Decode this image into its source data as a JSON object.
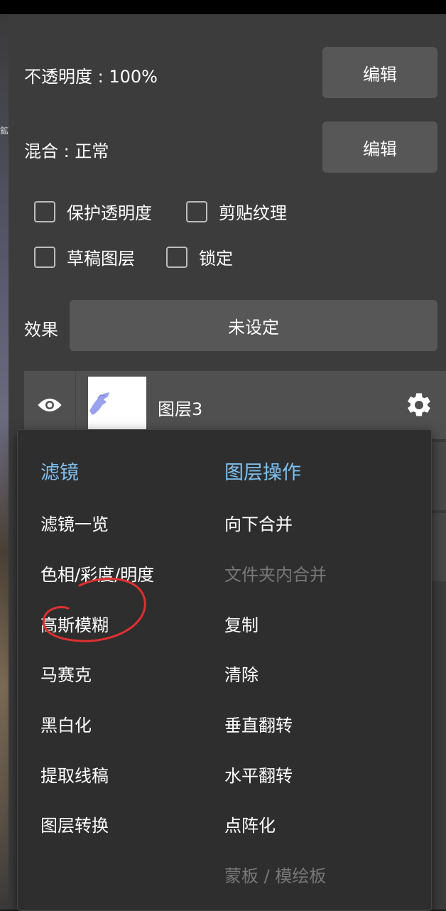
{
  "colors": {
    "panel": "#3c3c3c",
    "button": "#575757",
    "menu": "#2e2e2e",
    "accent": "#7ec0f0",
    "disabled": "#777777",
    "annotation": "#e03030"
  },
  "background": {
    "edge_glyph": "鉱"
  },
  "opacity": {
    "label": "不透明度 : 100%",
    "edit_label": "编辑"
  },
  "blend": {
    "label": "混合 : 正常",
    "edit_label": "编辑"
  },
  "checkboxes": [
    {
      "label": "保护透明度",
      "checked": false
    },
    {
      "label": "剪贴纹理",
      "checked": false
    },
    {
      "label": "草稿图层",
      "checked": false
    },
    {
      "label": "锁定",
      "checked": false
    }
  ],
  "effect": {
    "label": "效果",
    "value": "未设定"
  },
  "layer": {
    "name": "图层3",
    "visible": true,
    "icons": [
      "eye-icon",
      "gear-icon"
    ]
  },
  "menu": {
    "filters": {
      "heading": "滤镜",
      "items": [
        "滤镜一览",
        "色相/彩度/明度",
        "高斯模糊",
        "马赛克",
        "黑白化",
        "提取线稿",
        "图层转换"
      ]
    },
    "layer_ops": {
      "heading": "图层操作",
      "items": [
        {
          "label": "向下合并",
          "enabled": true
        },
        {
          "label": "文件夹内合并",
          "enabled": false
        },
        {
          "label": "复制",
          "enabled": true
        },
        {
          "label": "清除",
          "enabled": true
        },
        {
          "label": "垂直翻转",
          "enabled": true
        },
        {
          "label": "水平翻转",
          "enabled": true
        },
        {
          "label": "点阵化",
          "enabled": true
        },
        {
          "label": "蒙板 / 模绘板",
          "enabled": false
        }
      ]
    }
  }
}
